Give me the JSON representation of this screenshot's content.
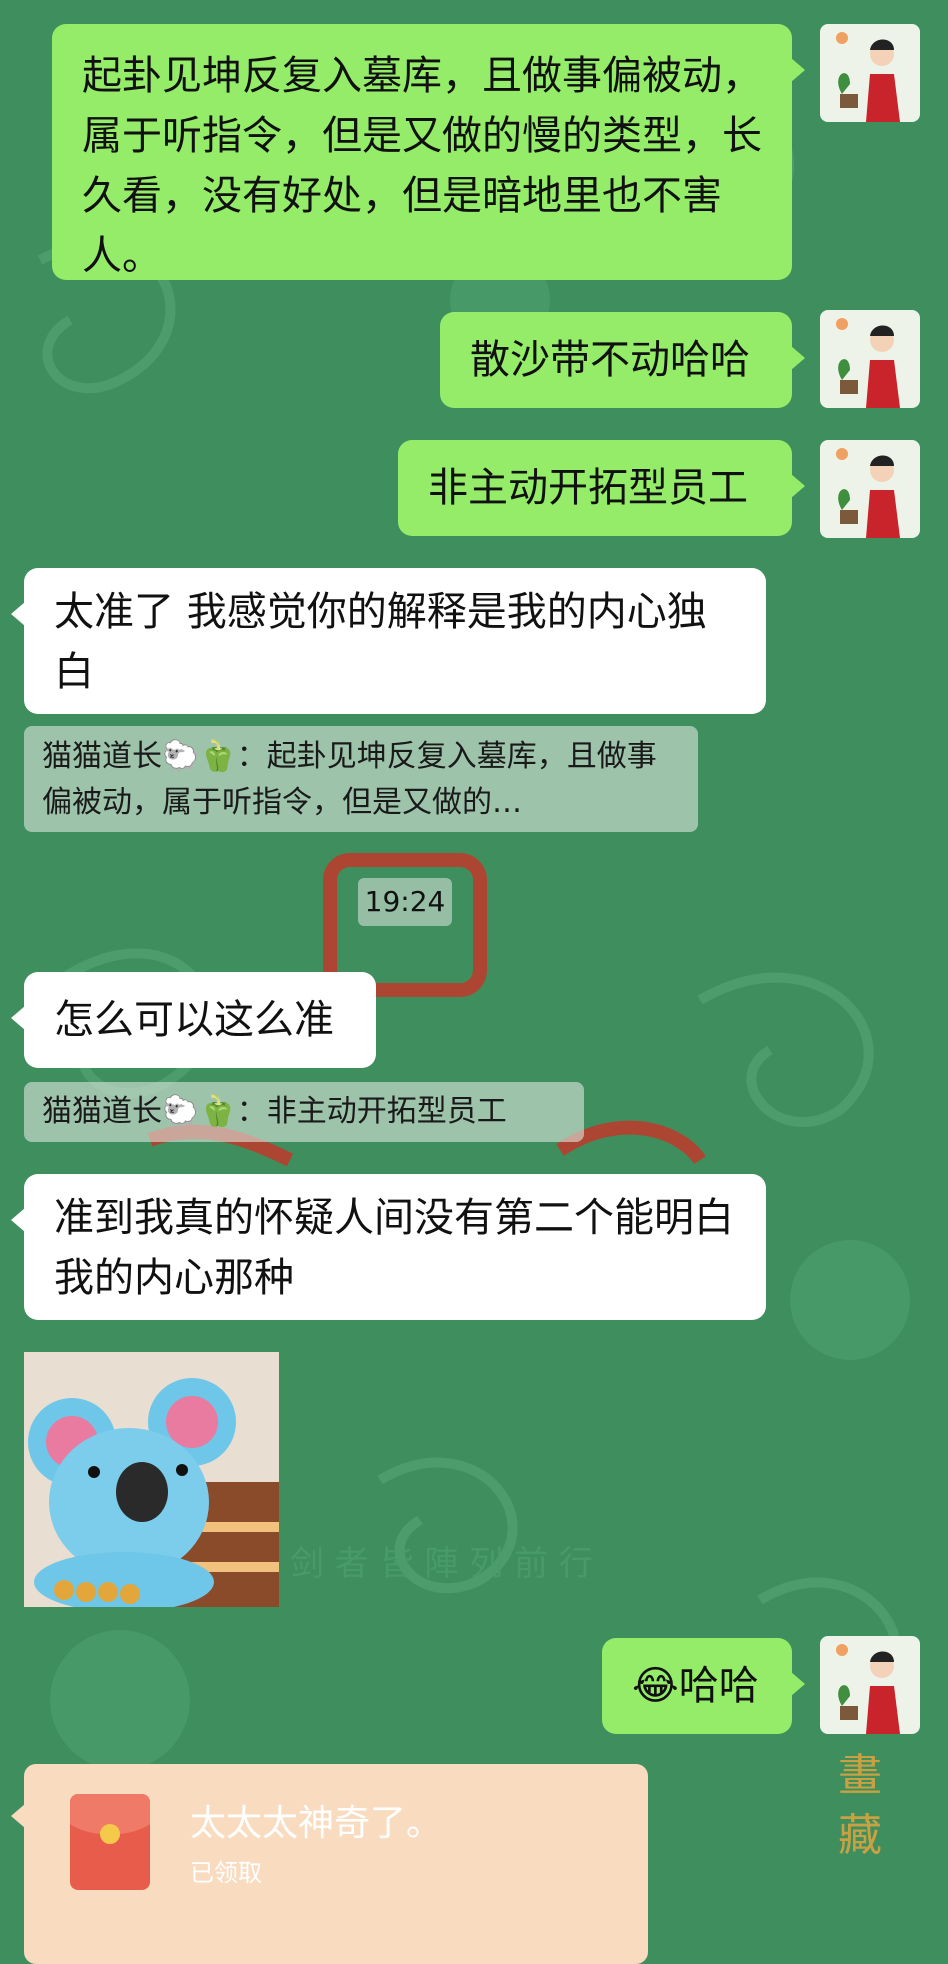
{
  "colors": {
    "background": "#3f8f5e",
    "sent_bubble": "#95ec69",
    "received_bubble": "#ffffff",
    "red_packet": "#f9dcc0",
    "red_packet_icon": "#e85c4c"
  },
  "messages": [
    {
      "side": "sent",
      "text": "起卦见坤反复入墓库，且做事偏被动，属于听指令，但是又做的慢的类型，长久看，没有好处，但是暗地里也不害人。"
    },
    {
      "side": "sent",
      "text": "散沙带不动哈哈"
    },
    {
      "side": "sent",
      "text": "非主动开拓型员工"
    },
    {
      "side": "received",
      "text": "太准了  我感觉你的解释是我的内心独白"
    },
    {
      "side": "quote",
      "sender": "猫猫道长🐑🫑",
      "text": "：起卦见坤反复入墓库，且做事偏被动，属于听指令，但是又做的…"
    },
    {
      "side": "time",
      "text": "19:24"
    },
    {
      "side": "received",
      "text": "怎么可以这么准"
    },
    {
      "side": "quote",
      "sender": "猫猫道长🐑🫑",
      "text": "：非主动开拓型员工"
    },
    {
      "side": "received",
      "text": "准到我真的怀疑人间没有第二个能明白我的内心那种"
    },
    {
      "side": "received",
      "type": "sticker",
      "icon": "koala-sticker"
    },
    {
      "side": "sent",
      "emoji": "😂",
      "text": "哈哈"
    },
    {
      "side": "received",
      "type": "red_packet",
      "title": "太太太神奇了。",
      "status": "已领取",
      "icon": "red-envelope-icon"
    }
  ]
}
